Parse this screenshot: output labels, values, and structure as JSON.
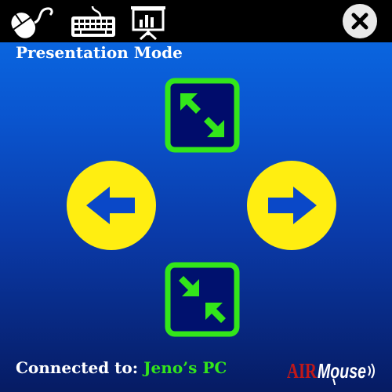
{
  "toolbar": {
    "icons": [
      "mouse-icon",
      "keyboard-icon",
      "presentation-icon",
      "close-icon"
    ]
  },
  "mode": {
    "title": "Presentation Mode"
  },
  "controls": {
    "fullscreen": "expand-arrows-icon",
    "previous": "arrow-left-icon",
    "next": "arrow-right-icon",
    "exit_fullscreen": "collapse-arrows-icon"
  },
  "status": {
    "label": "Connected to:",
    "device": "Jeno’s PC"
  },
  "brand": {
    "logo_text": "AIRMouse"
  },
  "colors": {
    "accent_green": "#33e61a",
    "button_yellow": "#ffee11",
    "arrow_blue": "#0a48c8",
    "topbar": "#000000"
  }
}
